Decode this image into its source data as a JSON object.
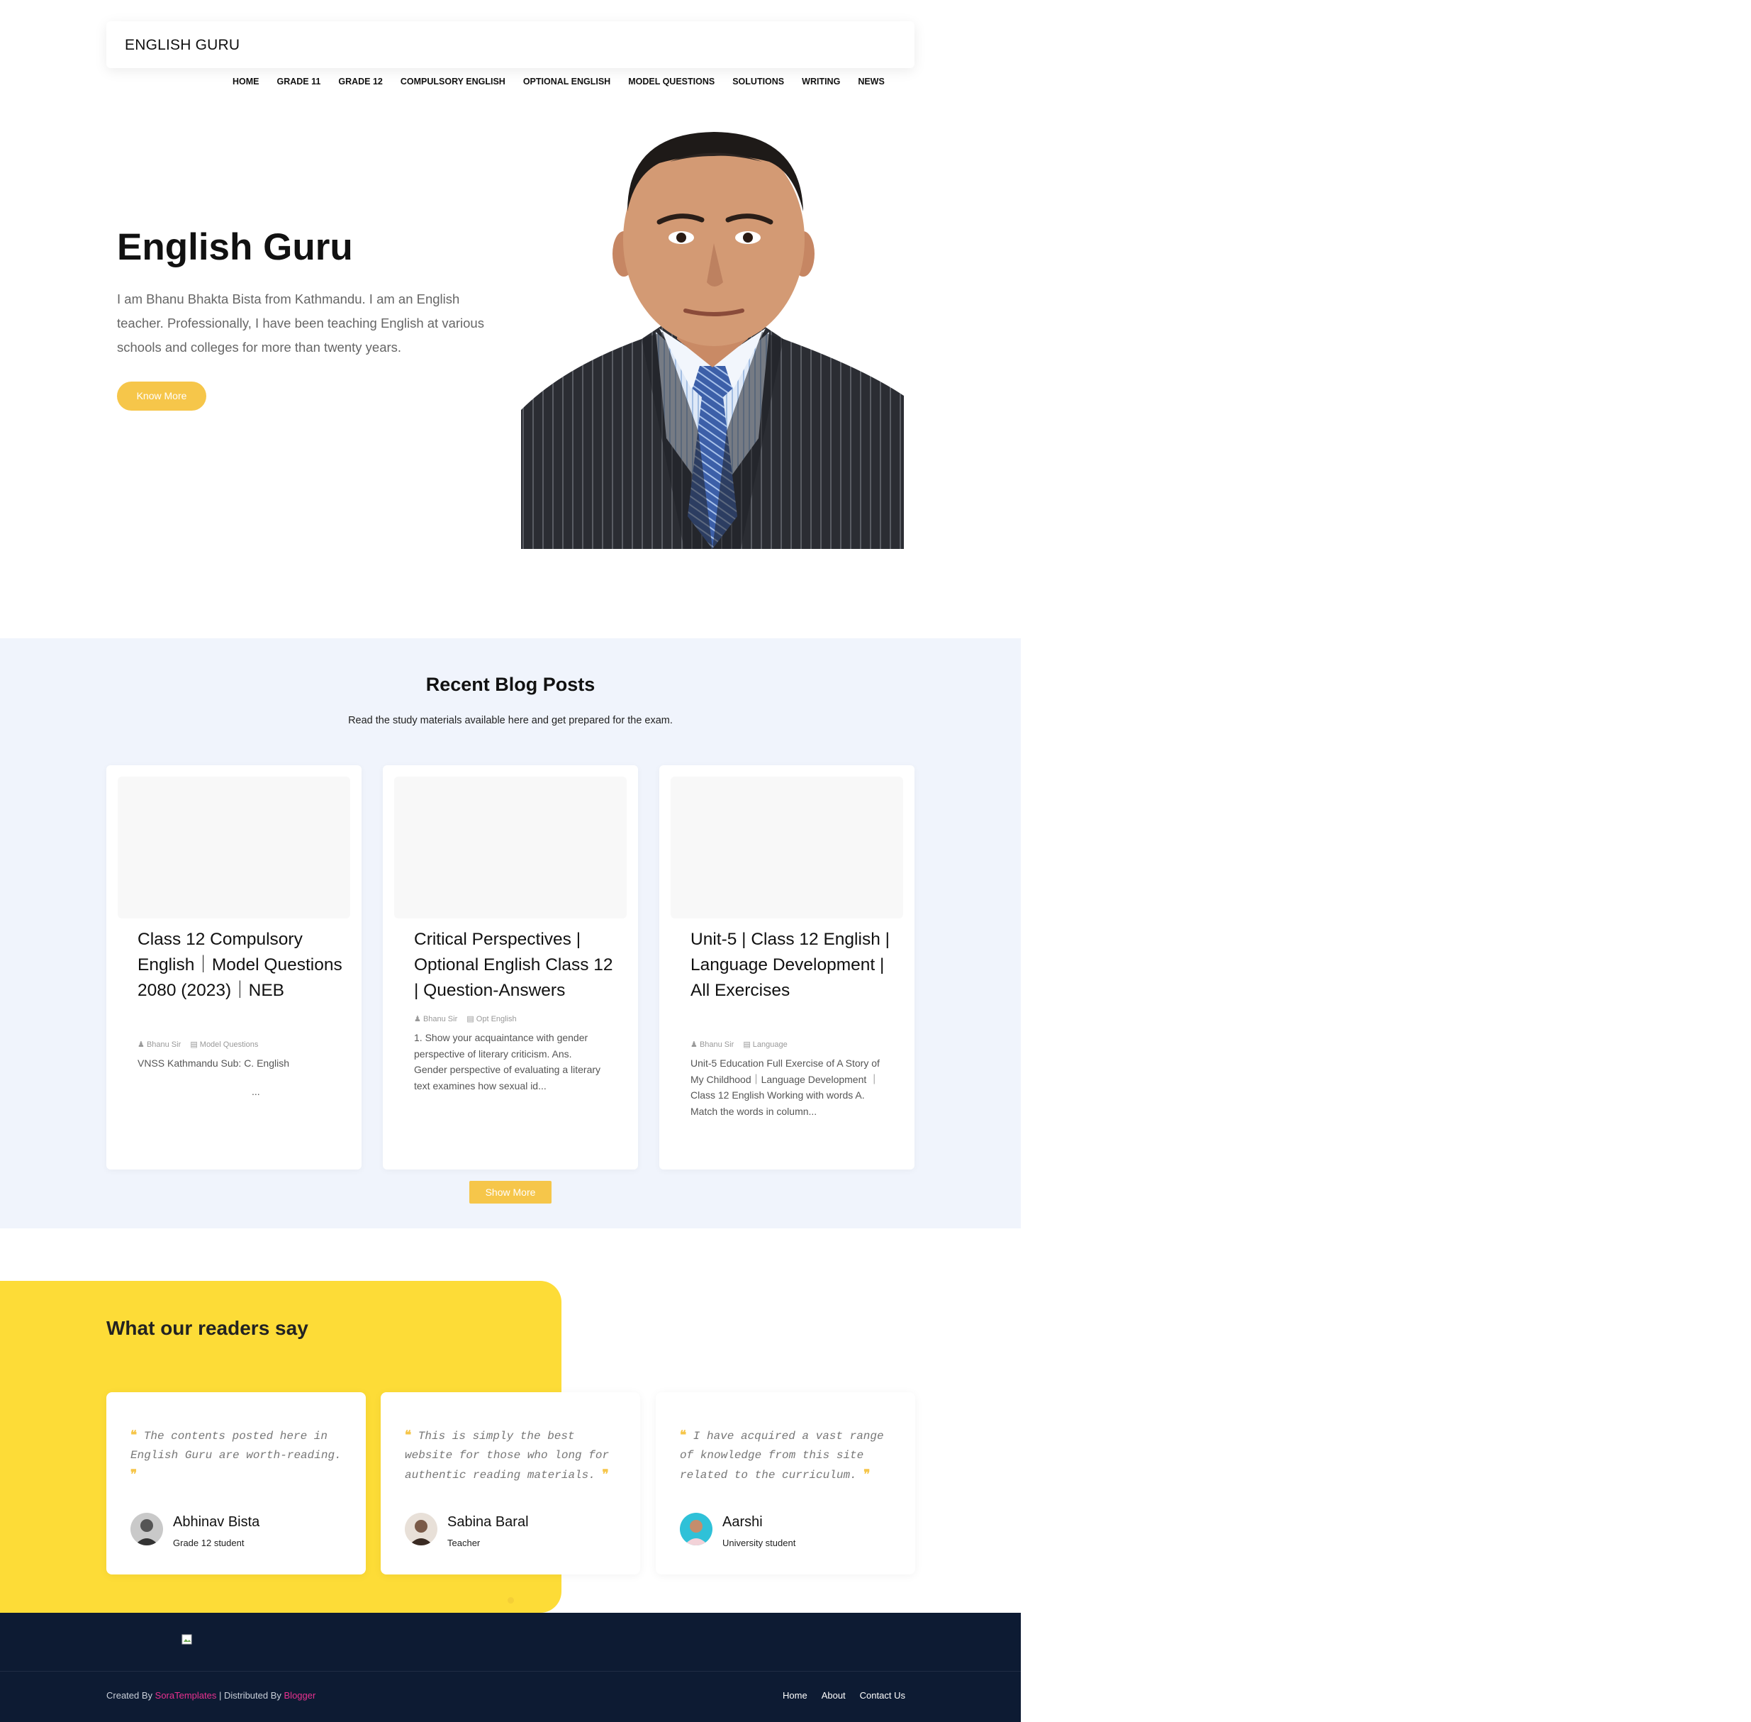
{
  "header": {
    "brand": "ENGLISH GURU",
    "nav": [
      "HOME",
      "GRADE 11",
      "GRADE 12",
      "COMPULSORY ENGLISH",
      "OPTIONAL ENGLISH",
      "MODEL QUESTIONS",
      "SOLUTIONS",
      "WRITING",
      "NEWS"
    ]
  },
  "hero": {
    "title": "English Guru",
    "description": "I am Bhanu Bhakta Bista from Kathmandu. I am an English teacher. Professionally, I have been teaching English at various schools and colleges for more than twenty years.",
    "button": "Know More",
    "image_icon": "portrait-photo"
  },
  "blog": {
    "heading": "Recent Blog Posts",
    "subheading": "Read the study materials available here and get prepared for the exam.",
    "posts": [
      {
        "title": "Class 12 Compulsory English｜Model Questions 2080 (2023)｜NEB",
        "author": "Bhanu Sir",
        "category": "Model Questions",
        "excerpt": "VNSS Kathmandu Sub: C. English",
        "more": "..."
      },
      {
        "title": "Critical Perspectives | Optional English Class 12 | Question-Answers",
        "author": "Bhanu Sir",
        "category": "Opt English",
        "excerpt": "1. Show your acquaintance with gender perspective of literary criticism. Ans. Gender perspective of evaluating a literary text examines how sexual id..."
      },
      {
        "title": "Unit-5 | Class 12 English | Language Development | All Exercises",
        "author": "Bhanu Sir",
        "category": "Language",
        "excerpt": "Unit-5 Education Full Exercise of A Story of My Childhood｜Language Development ｜ Class 12 English Working with words A. Match the words in column..."
      }
    ],
    "show_more": "Show More"
  },
  "testimonials": {
    "heading": "What our readers say",
    "items": [
      {
        "quote": "The contents posted here in English Guru are worth-reading.",
        "name": "Abhinav Bista",
        "role": "Grade 12 student"
      },
      {
        "quote": "This is simply the best website for those who long for authentic reading materials.",
        "name": "Sabina Baral",
        "role": "Teacher"
      },
      {
        "quote": "I have acquired a vast range of knowledge from this site related to the curriculum.",
        "name": "Aarshi",
        "role": "University student"
      }
    ],
    "open_quote": "❝",
    "close_quote": "❞"
  },
  "footer": {
    "created_by": "Created By ",
    "sora": "SoraTemplates",
    "distributed": " | Distributed By ",
    "blogger": "Blogger",
    "links": [
      "Home",
      "About",
      "Contact Us"
    ]
  },
  "colors": {
    "accent": "#f6c64a",
    "yellow_panel": "#fddc37",
    "blog_bg": "#f0f4fc",
    "footer_bg": "#0d1b33",
    "link_pink": "#e8318f"
  }
}
